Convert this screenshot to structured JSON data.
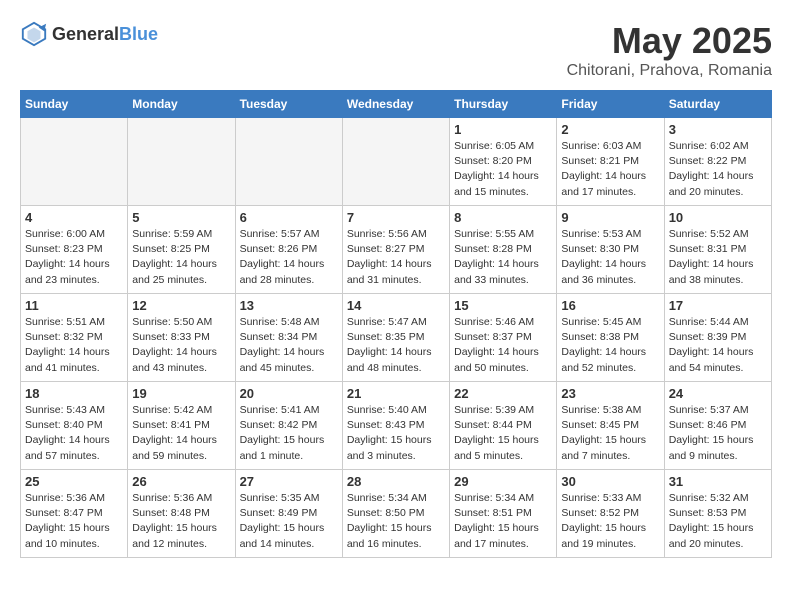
{
  "header": {
    "logo_general": "General",
    "logo_blue": "Blue",
    "month_year": "May 2025",
    "location": "Chitorani, Prahova, Romania"
  },
  "weekdays": [
    "Sunday",
    "Monday",
    "Tuesday",
    "Wednesday",
    "Thursday",
    "Friday",
    "Saturday"
  ],
  "weeks": [
    [
      {
        "day": "",
        "info": ""
      },
      {
        "day": "",
        "info": ""
      },
      {
        "day": "",
        "info": ""
      },
      {
        "day": "",
        "info": ""
      },
      {
        "day": "1",
        "info": "Sunrise: 6:05 AM\nSunset: 8:20 PM\nDaylight: 14 hours\nand 15 minutes."
      },
      {
        "day": "2",
        "info": "Sunrise: 6:03 AM\nSunset: 8:21 PM\nDaylight: 14 hours\nand 17 minutes."
      },
      {
        "day": "3",
        "info": "Sunrise: 6:02 AM\nSunset: 8:22 PM\nDaylight: 14 hours\nand 20 minutes."
      }
    ],
    [
      {
        "day": "4",
        "info": "Sunrise: 6:00 AM\nSunset: 8:23 PM\nDaylight: 14 hours\nand 23 minutes."
      },
      {
        "day": "5",
        "info": "Sunrise: 5:59 AM\nSunset: 8:25 PM\nDaylight: 14 hours\nand 25 minutes."
      },
      {
        "day": "6",
        "info": "Sunrise: 5:57 AM\nSunset: 8:26 PM\nDaylight: 14 hours\nand 28 minutes."
      },
      {
        "day": "7",
        "info": "Sunrise: 5:56 AM\nSunset: 8:27 PM\nDaylight: 14 hours\nand 31 minutes."
      },
      {
        "day": "8",
        "info": "Sunrise: 5:55 AM\nSunset: 8:28 PM\nDaylight: 14 hours\nand 33 minutes."
      },
      {
        "day": "9",
        "info": "Sunrise: 5:53 AM\nSunset: 8:30 PM\nDaylight: 14 hours\nand 36 minutes."
      },
      {
        "day": "10",
        "info": "Sunrise: 5:52 AM\nSunset: 8:31 PM\nDaylight: 14 hours\nand 38 minutes."
      }
    ],
    [
      {
        "day": "11",
        "info": "Sunrise: 5:51 AM\nSunset: 8:32 PM\nDaylight: 14 hours\nand 41 minutes."
      },
      {
        "day": "12",
        "info": "Sunrise: 5:50 AM\nSunset: 8:33 PM\nDaylight: 14 hours\nand 43 minutes."
      },
      {
        "day": "13",
        "info": "Sunrise: 5:48 AM\nSunset: 8:34 PM\nDaylight: 14 hours\nand 45 minutes."
      },
      {
        "day": "14",
        "info": "Sunrise: 5:47 AM\nSunset: 8:35 PM\nDaylight: 14 hours\nand 48 minutes."
      },
      {
        "day": "15",
        "info": "Sunrise: 5:46 AM\nSunset: 8:37 PM\nDaylight: 14 hours\nand 50 minutes."
      },
      {
        "day": "16",
        "info": "Sunrise: 5:45 AM\nSunset: 8:38 PM\nDaylight: 14 hours\nand 52 minutes."
      },
      {
        "day": "17",
        "info": "Sunrise: 5:44 AM\nSunset: 8:39 PM\nDaylight: 14 hours\nand 54 minutes."
      }
    ],
    [
      {
        "day": "18",
        "info": "Sunrise: 5:43 AM\nSunset: 8:40 PM\nDaylight: 14 hours\nand 57 minutes."
      },
      {
        "day": "19",
        "info": "Sunrise: 5:42 AM\nSunset: 8:41 PM\nDaylight: 14 hours\nand 59 minutes."
      },
      {
        "day": "20",
        "info": "Sunrise: 5:41 AM\nSunset: 8:42 PM\nDaylight: 15 hours\nand 1 minute."
      },
      {
        "day": "21",
        "info": "Sunrise: 5:40 AM\nSunset: 8:43 PM\nDaylight: 15 hours\nand 3 minutes."
      },
      {
        "day": "22",
        "info": "Sunrise: 5:39 AM\nSunset: 8:44 PM\nDaylight: 15 hours\nand 5 minutes."
      },
      {
        "day": "23",
        "info": "Sunrise: 5:38 AM\nSunset: 8:45 PM\nDaylight: 15 hours\nand 7 minutes."
      },
      {
        "day": "24",
        "info": "Sunrise: 5:37 AM\nSunset: 8:46 PM\nDaylight: 15 hours\nand 9 minutes."
      }
    ],
    [
      {
        "day": "25",
        "info": "Sunrise: 5:36 AM\nSunset: 8:47 PM\nDaylight: 15 hours\nand 10 minutes."
      },
      {
        "day": "26",
        "info": "Sunrise: 5:36 AM\nSunset: 8:48 PM\nDaylight: 15 hours\nand 12 minutes."
      },
      {
        "day": "27",
        "info": "Sunrise: 5:35 AM\nSunset: 8:49 PM\nDaylight: 15 hours\nand 14 minutes."
      },
      {
        "day": "28",
        "info": "Sunrise: 5:34 AM\nSunset: 8:50 PM\nDaylight: 15 hours\nand 16 minutes."
      },
      {
        "day": "29",
        "info": "Sunrise: 5:34 AM\nSunset: 8:51 PM\nDaylight: 15 hours\nand 17 minutes."
      },
      {
        "day": "30",
        "info": "Sunrise: 5:33 AM\nSunset: 8:52 PM\nDaylight: 15 hours\nand 19 minutes."
      },
      {
        "day": "31",
        "info": "Sunrise: 5:32 AM\nSunset: 8:53 PM\nDaylight: 15 hours\nand 20 minutes."
      }
    ]
  ]
}
